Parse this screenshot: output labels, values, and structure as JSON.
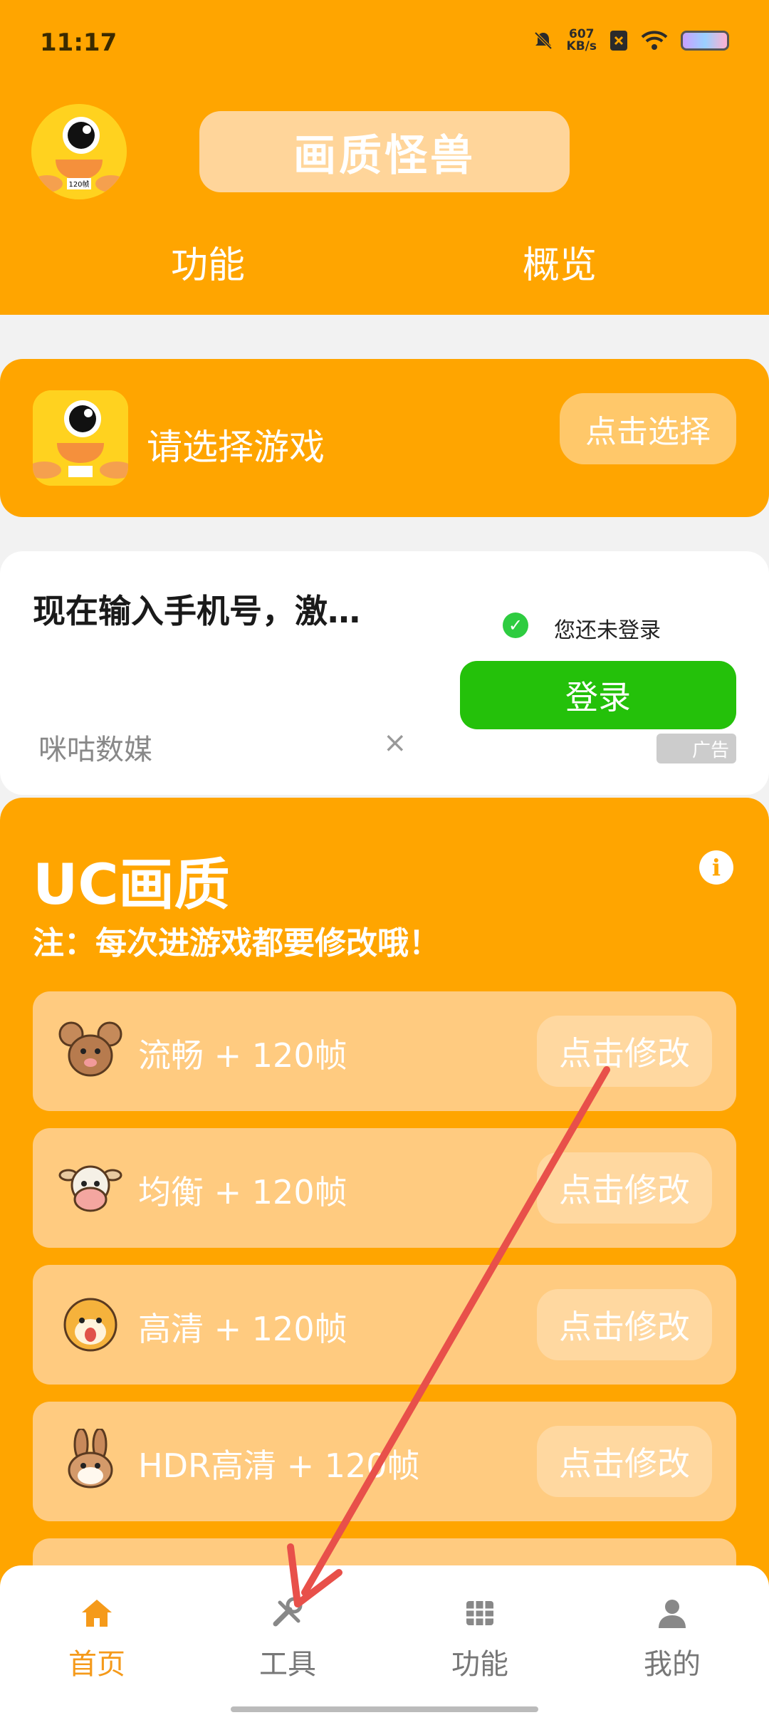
{
  "status_bar": {
    "time": "11:17",
    "net_speed": "607",
    "net_unit": "KB/s"
  },
  "header": {
    "app_title": "画质怪兽",
    "tabs": [
      {
        "label": "功能"
      },
      {
        "label": "概览"
      }
    ],
    "logo_badge": "120帧"
  },
  "game_select": {
    "label": "请选择游戏",
    "button": "点击选择"
  },
  "ad": {
    "title": "现在输入手机号，激…",
    "status": "您还未登录",
    "login_button": "登录",
    "source": "咪咕数媒",
    "close": "×",
    "badge": "广告"
  },
  "quality": {
    "title": "UC画质",
    "info": "i",
    "note": "注：每次进游戏都要修改哦！",
    "modes": [
      {
        "label": "流畅  + 120帧",
        "button": "点击修改",
        "icon": "mouse-icon"
      },
      {
        "label": "均衡  + 120帧",
        "button": "点击修改",
        "icon": "cow-icon"
      },
      {
        "label": "高清  + 120帧",
        "button": "点击修改",
        "icon": "tiger-icon"
      },
      {
        "label": "HDR高清  + 120帧",
        "button": "点击修改",
        "icon": "rabbit-icon"
      }
    ]
  },
  "bottom_nav": [
    {
      "label": "首页",
      "icon": "home-icon",
      "active": true
    },
    {
      "label": "工具",
      "icon": "tools-icon",
      "active": false
    },
    {
      "label": "功能",
      "icon": "grid-icon",
      "active": false
    },
    {
      "label": "我的",
      "icon": "user-icon",
      "active": false
    }
  ],
  "colors": {
    "accent": "#FFA500",
    "login_green": "#24C10A",
    "nav_active": "#F59A1A",
    "annotation_arrow": "#E8504A"
  }
}
